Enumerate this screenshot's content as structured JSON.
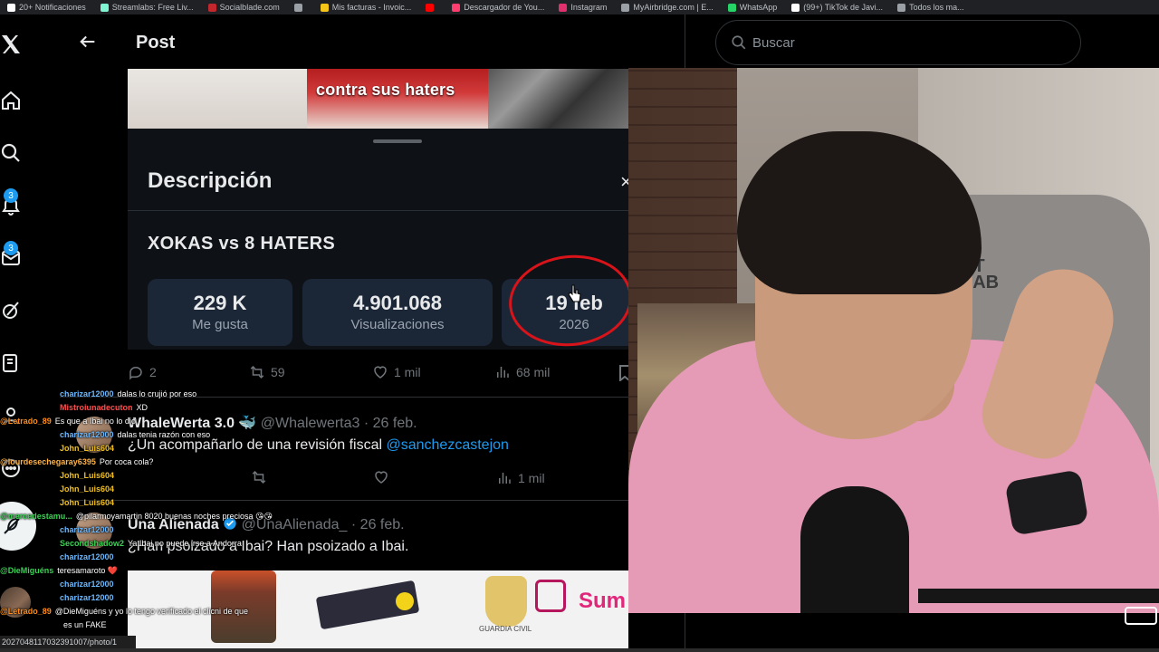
{
  "bookmarks": [
    {
      "label": "20+ Notificaciones",
      "color": "#ffffff"
    },
    {
      "label": "Streamlabs: Free Liv...",
      "color": "#80f5d2"
    },
    {
      "label": "Socialblade.com",
      "color": "#c1272d"
    },
    {
      "label": "",
      "color": "#9aa0a6"
    },
    {
      "label": "Mis facturas - Invoic...",
      "color": "#f5c518"
    },
    {
      "label": "",
      "color": "#ff0000"
    },
    {
      "label": "Descargador de You...",
      "color": "#ff3d6e"
    },
    {
      "label": "Instagram",
      "color": "#e1306c"
    },
    {
      "label": "MyAirbridge.com | E...",
      "color": "#9aa0a6"
    },
    {
      "label": "WhatsApp",
      "color": "#25d366"
    },
    {
      "label": "(99+) TikTok de Javi...",
      "color": "#ffffff"
    },
    {
      "label": "Todos los ma...",
      "color": "#9aa0a6"
    }
  ],
  "sidebar": {
    "notifications_badge": "3",
    "messages_badge": "3"
  },
  "post": {
    "title": "Post",
    "embedded": {
      "thumb_text": "contra sus haters",
      "sheet_title": "Descripción",
      "close": "×",
      "video_title": "XOKAS vs 8 HATERS",
      "stats": [
        {
          "value": "229 K",
          "label": "Me gusta"
        },
        {
          "value": "4.901.068",
          "label": "Visualizaciones"
        },
        {
          "value": "19 feb",
          "label": "2026"
        }
      ]
    },
    "actions": {
      "replies": "2",
      "reposts": "59",
      "likes": "1 mil",
      "views": "68 mil"
    }
  },
  "replies": [
    {
      "name": "WhaleWerta 3.0",
      "emoji": "🐳",
      "handle": "@Whalewerta3",
      "date": "· 26 feb.",
      "text": "¿Un acompañarlo de una revisión fiscal",
      "mention": "@sanchezcastejon",
      "views": "1 mil"
    },
    {
      "name": "Una Alienada",
      "handle": "@UnaAlienada_",
      "date": "· 26 feb.",
      "text": "¿Han psoizado a Ibai? Han psoizado a Ibai.",
      "mention": ""
    }
  ],
  "image_strip": {
    "caption": "GUARDIA CIVIL",
    "brand": "Sum"
  },
  "search": {
    "placeholder": "Buscar"
  },
  "webcam": {
    "chair_text": "ET\nLAB"
  },
  "chat": [
    {
      "user": "charizar12000",
      "msg": "dalas lo crujió por eso",
      "color": "#6bb8ff"
    },
    {
      "user": "Mistroiunadecuton",
      "msg": "XD",
      "color": "#ff4d4d"
    },
    {
      "user": "@Letrado_89",
      "msg": "Es que a Ibai no lo dio",
      "color": "#ff8c1a"
    },
    {
      "user": "charizar12000",
      "msg": "dalas tenia razón con eso",
      "color": "#6bb8ff"
    },
    {
      "user": "John_Luis604",
      "msg": "",
      "color": "#f0c020"
    },
    {
      "user": "@lourdesechegaray6395",
      "msg": "Por coca cola?",
      "color": "#ffb347"
    },
    {
      "user": "John_Luis604",
      "msg": "",
      "color": "#f0c020"
    },
    {
      "user": "John_Luis604",
      "msg": "",
      "color": "#f0c020"
    },
    {
      "user": "John_Luis604",
      "msg": "",
      "color": "#f0c020"
    },
    {
      "user": "@mercedestamu...",
      "msg": "@pilarmoyamartin 8020 buenas noches preciosa 😘😘",
      "color": "#39d353"
    },
    {
      "user": "charizar12000",
      "msg": "",
      "color": "#6bb8ff"
    },
    {
      "user": "Secondshadow2",
      "msg": "Ya Ibai no puede irse a Andorra",
      "color": "#39d353"
    },
    {
      "user": "charizar12000",
      "msg": "",
      "color": "#6bb8ff"
    },
    {
      "user": "@DieMiguéns",
      "msg": "teresamaroto ❤️",
      "color": "#39d353"
    },
    {
      "user": "charizar12000",
      "msg": "",
      "color": "#6bb8ff"
    },
    {
      "user": "charizar12000",
      "msg": "",
      "color": "#6bb8ff"
    },
    {
      "user": "@Letrado_89",
      "msg": "@DieMiguéns y yo lo tengo verificado el clicni de que",
      "color": "#ff8c1a"
    },
    {
      "user": "",
      "msg": "es un FAKE",
      "color": "#ffffff"
    }
  ],
  "status_url": "2027048117032391007/photo/1"
}
